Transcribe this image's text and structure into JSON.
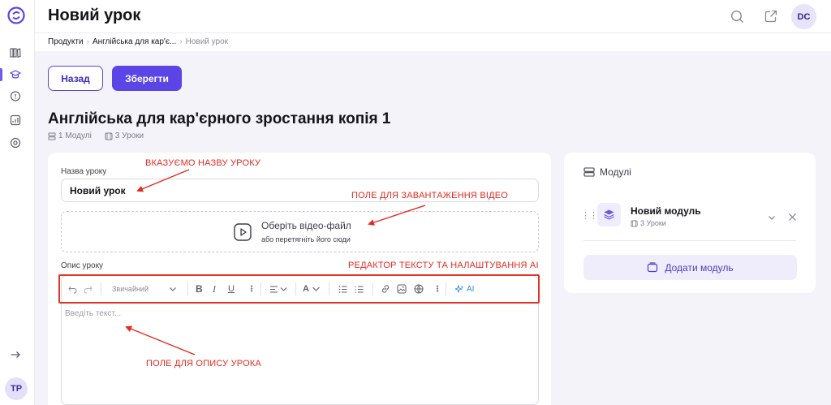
{
  "header": {
    "title": "Новий урок",
    "user_initials": "DC"
  },
  "sidebar": {
    "user_initials": "TP",
    "items": [
      {
        "icon": "library-icon"
      },
      {
        "icon": "graduation-cap-icon"
      },
      {
        "icon": "feedback-icon"
      },
      {
        "icon": "analytics-icon"
      },
      {
        "icon": "settings-icon"
      }
    ]
  },
  "breadcrumb": {
    "items": [
      "Продукти",
      "Англійська для кар'є..."
    ],
    "current": "Новий урок"
  },
  "actions": {
    "back_label": "Назад",
    "save_label": "Зберегти"
  },
  "course": {
    "title": "Англійська для кар'єрного зростання копія 1",
    "modules_count": "1 Модулі",
    "lessons_count": "3 Уроки"
  },
  "lesson_form": {
    "name_label": "Назва уроку",
    "name_value": "Новий урок",
    "video_title": "Оберіть відео-файл",
    "video_subtitle": "або перетягніть його сюди",
    "description_label": "Опис уроку",
    "editor_placeholder": "Введіть текст...",
    "text_style": "Звичайний",
    "ai_label": "AI"
  },
  "modules_panel": {
    "title": "Модулі",
    "module_name": "Новий модуль",
    "module_lessons": "3 Уроки",
    "add_module_label": "Додати модуль"
  },
  "annotations": {
    "lesson_name": "ВКАЗУЄМО НАЗВУ УРОКУ",
    "video_field": "ПОЛЕ ДЛЯ ЗАВАНТАЖЕННЯ ВІДЕО",
    "editor_ai": "РЕДАКТОР ТЕКСТУ ТА НАЛАШТУВАННЯ AI",
    "description_field": "ПОЛЕ ДЛЯ ОПИСУ УРОКА"
  },
  "colors": {
    "accent": "#5b45e6",
    "annotation_red": "#e32b22",
    "background": "#f4f3f9"
  }
}
